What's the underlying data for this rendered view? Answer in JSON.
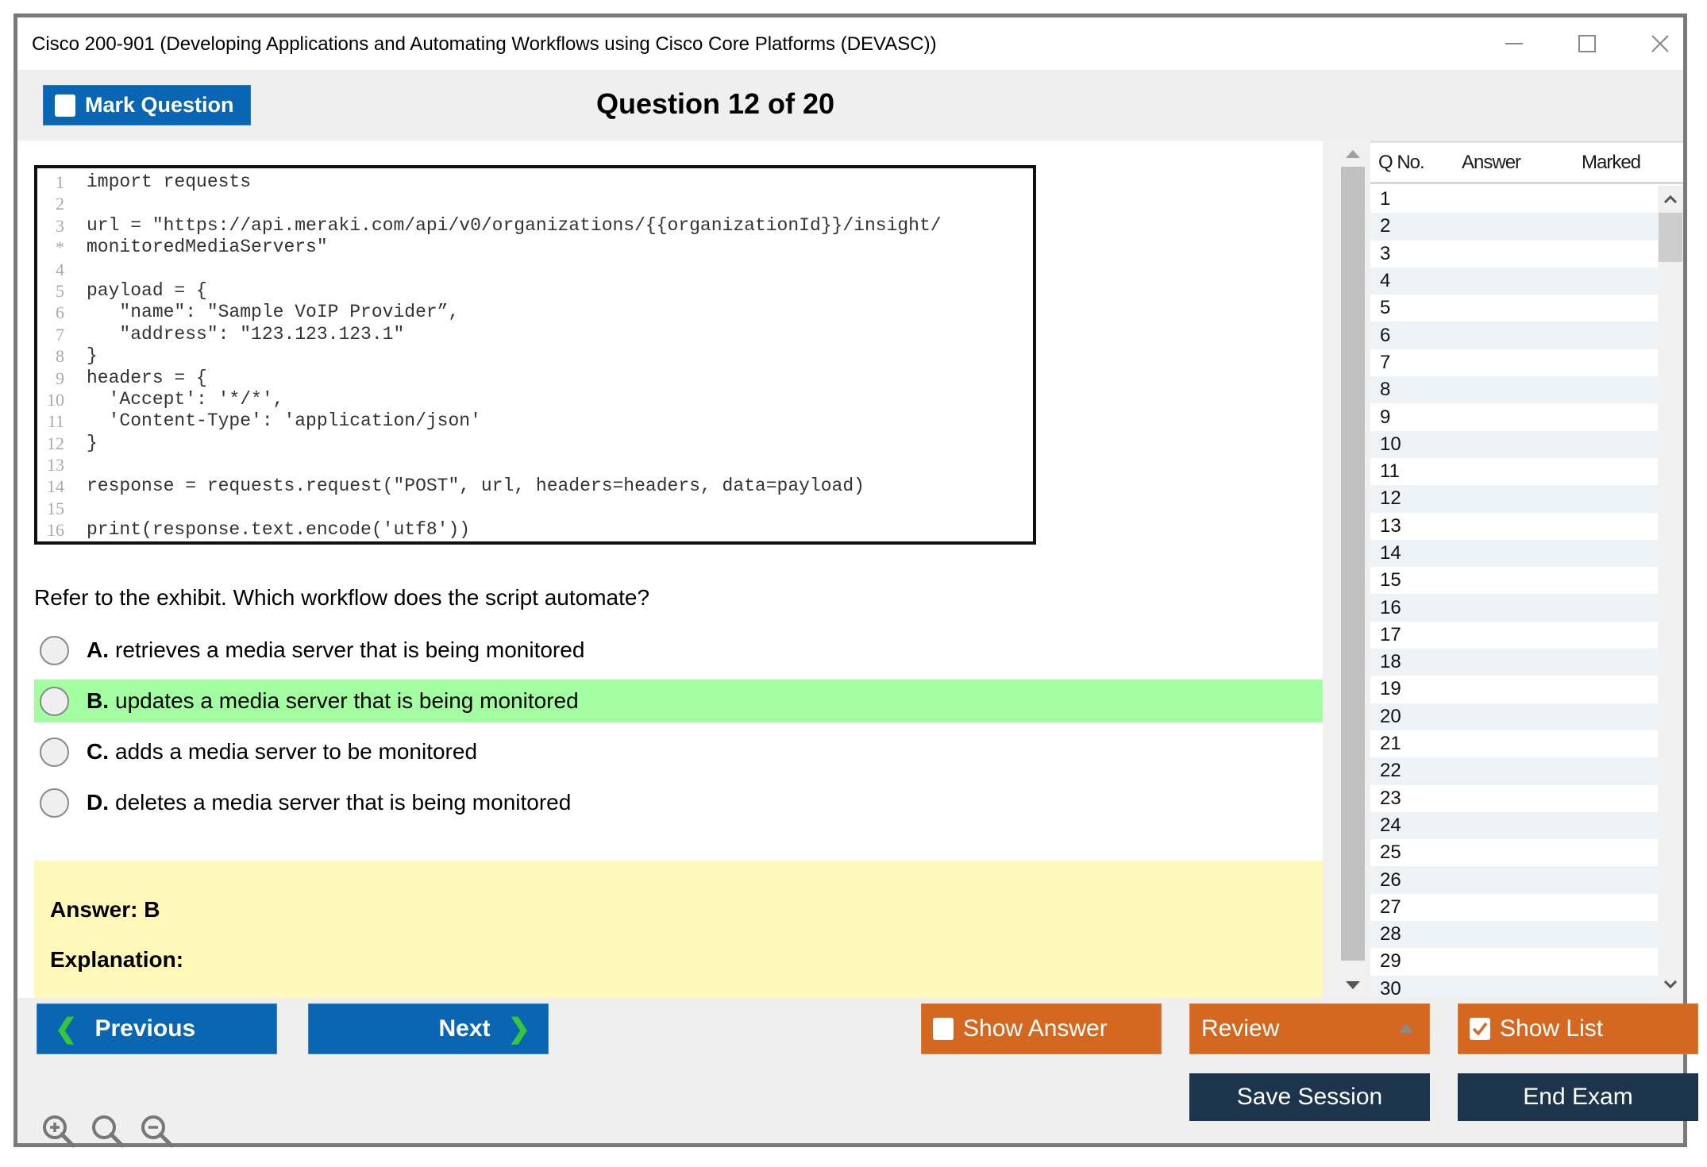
{
  "window": {
    "title": "Cisco 200-901 (Developing Applications and Automating Workflows using Cisco Core Platforms (DEVASC))",
    "controls": [
      "minimize-icon",
      "maximize-icon",
      "close-icon"
    ]
  },
  "header": {
    "mark_question_label": "Mark Question",
    "question_title": "Question 12 of 20"
  },
  "exhibit": {
    "lines": [
      {
        "n": "1",
        "code": "import requests"
      },
      {
        "n": "2",
        "code": ""
      },
      {
        "n": "3",
        "code": "url = \"https://api.meraki.com/api/v0/organizations/{{organizationId}}/insight/"
      },
      {
        "n": "*",
        "code": "monitoredMediaServers\""
      },
      {
        "n": "4",
        "code": ""
      },
      {
        "n": "5",
        "code": "payload = {"
      },
      {
        "n": "6",
        "code": "   \"name\": \"Sample VoIP Provider”,"
      },
      {
        "n": "7",
        "code": "   \"address\": \"123.123.123.1\""
      },
      {
        "n": "8",
        "code": "}"
      },
      {
        "n": "9",
        "code": "headers = {"
      },
      {
        "n": "10",
        "code": "  'Accept': '*/*',"
      },
      {
        "n": "11",
        "code": "  'Content-Type': 'application/json'"
      },
      {
        "n": "12",
        "code": "}"
      },
      {
        "n": "13",
        "code": ""
      },
      {
        "n": "14",
        "code": "response = requests.request(\"POST\", url, headers=headers, data=payload)"
      },
      {
        "n": "15",
        "code": ""
      },
      {
        "n": "16",
        "code": "print(response.text.encode('utf8'))"
      }
    ]
  },
  "question": {
    "text": "Refer to the exhibit. Which workflow does the script automate?",
    "options": [
      {
        "letter": "A.",
        "text": "retrieves a media server that is being monitored",
        "highlighted": false
      },
      {
        "letter": "B.",
        "text": "updates a media server that is being monitored",
        "highlighted": true
      },
      {
        "letter": "C.",
        "text": "adds a media server to be monitored",
        "highlighted": false
      },
      {
        "letter": "D.",
        "text": "deletes a media server that is being monitored",
        "highlighted": false
      }
    ],
    "answer_label": "Answer: B",
    "explanation_label": "Explanation:"
  },
  "question_list": {
    "columns": [
      "Q No.",
      "Answer",
      "Marked"
    ],
    "rows": [
      "1",
      "2",
      "3",
      "4",
      "5",
      "6",
      "7",
      "8",
      "9",
      "10",
      "11",
      "12",
      "13",
      "14",
      "15",
      "16",
      "17",
      "18",
      "19",
      "20",
      "21",
      "22",
      "23",
      "24",
      "25",
      "26",
      "27",
      "28",
      "29",
      "30"
    ]
  },
  "footer": {
    "previous_label": "Previous",
    "next_label": "Next",
    "show_answer_label": "Show Answer",
    "show_answer_checked": false,
    "review_label": "Review",
    "show_list_label": "Show List",
    "show_list_checked": true,
    "save_session_label": "Save Session",
    "end_exam_label": "End Exam",
    "zoom_icons": [
      "zoom-in-icon",
      "zoom-reset-icon",
      "zoom-out-icon"
    ]
  },
  "colors": {
    "primary_blue": "#0a66b2",
    "orange": "#d46820",
    "navy": "#1c354d",
    "correct_highlight": "#a3fea1",
    "answer_box": "#fff8b9",
    "nav_arrow": "#35c63a"
  }
}
